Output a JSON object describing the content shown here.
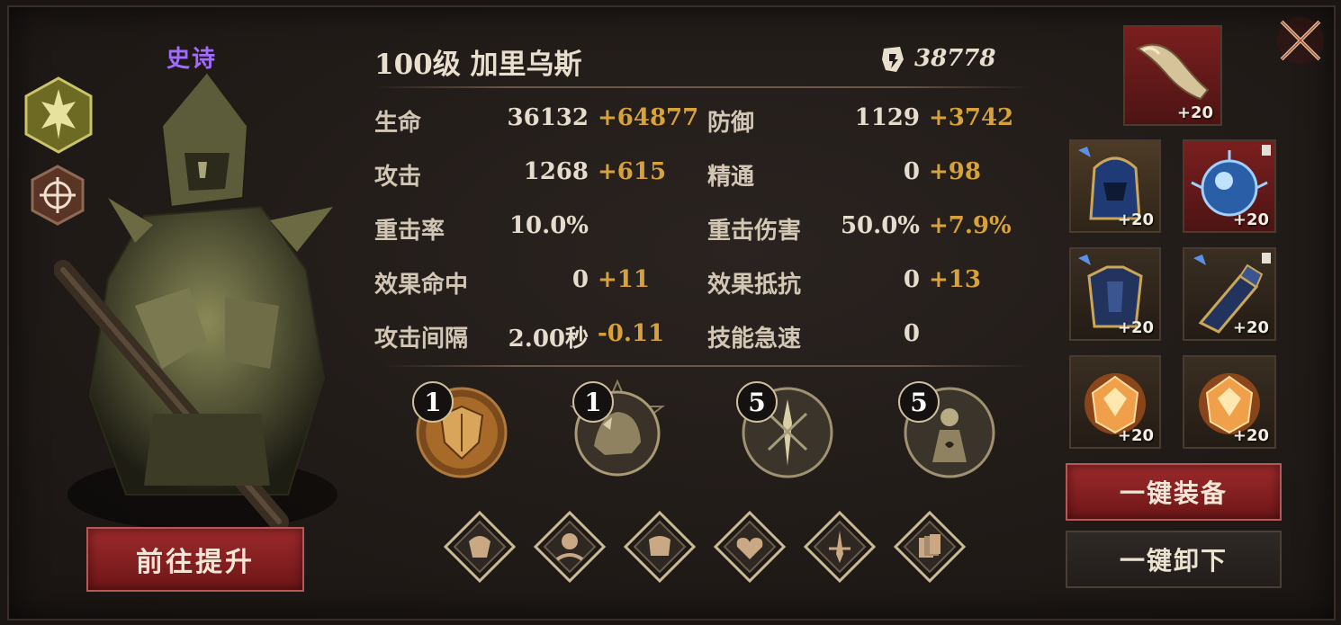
{
  "hero": {
    "rarity": "史诗",
    "title": "100级 加里乌斯",
    "power": "38778"
  },
  "stats": [
    {
      "label": "生命",
      "base": "36132",
      "bonus": "+64877"
    },
    {
      "label": "防御",
      "base": "1129",
      "bonus": "+3742"
    },
    {
      "label": "攻击",
      "base": "1268",
      "bonus": "+615"
    },
    {
      "label": "精通",
      "base": "0",
      "bonus": "+98"
    },
    {
      "label": "重击率",
      "base": "10.0%",
      "bonus": ""
    },
    {
      "label": "重击伤害",
      "base": "50.0%",
      "bonus": "+7.9%"
    },
    {
      "label": "效果命中",
      "base": "0",
      "bonus": "+11"
    },
    {
      "label": "效果抵抗",
      "base": "0",
      "bonus": "+13"
    },
    {
      "label": "攻击间隔",
      "base": "2.00秒",
      "bonus": "-0.11"
    },
    {
      "label": "技能急速",
      "base": "0",
      "bonus": ""
    }
  ],
  "skills": [
    {
      "level": "1",
      "icon": "shield-skill-icon"
    },
    {
      "level": "1",
      "icon": "beast-skill-icon"
    },
    {
      "level": "5",
      "icon": "trident-skill-icon"
    },
    {
      "level": "5",
      "icon": "figure-skill-icon"
    }
  ],
  "runes": [
    "rune-1-icon",
    "rune-2-icon",
    "rune-3-icon",
    "rune-heart-icon",
    "rune-sword-icon",
    "rune-stack-icon"
  ],
  "equipment": {
    "accessory": {
      "enhance": "+20",
      "icon": "horn-icon"
    },
    "slots": [
      {
        "enhance": "+20",
        "icon": "helmet-icon"
      },
      {
        "enhance": "+20",
        "icon": "orb-icon"
      },
      {
        "enhance": "+20",
        "icon": "armor-icon"
      },
      {
        "enhance": "+20",
        "icon": "gauntlet-icon"
      },
      {
        "enhance": "+20",
        "icon": "gem-icon"
      },
      {
        "enhance": "+20",
        "icon": "gem-icon"
      }
    ]
  },
  "buttons": {
    "promote": "前往提升",
    "equip_all": "一键装备",
    "unequip_all": "一键卸下"
  },
  "colors": {
    "rarity": "#a26bff",
    "bonus": "#d7a23a",
    "red_button": "#8a2224"
  }
}
